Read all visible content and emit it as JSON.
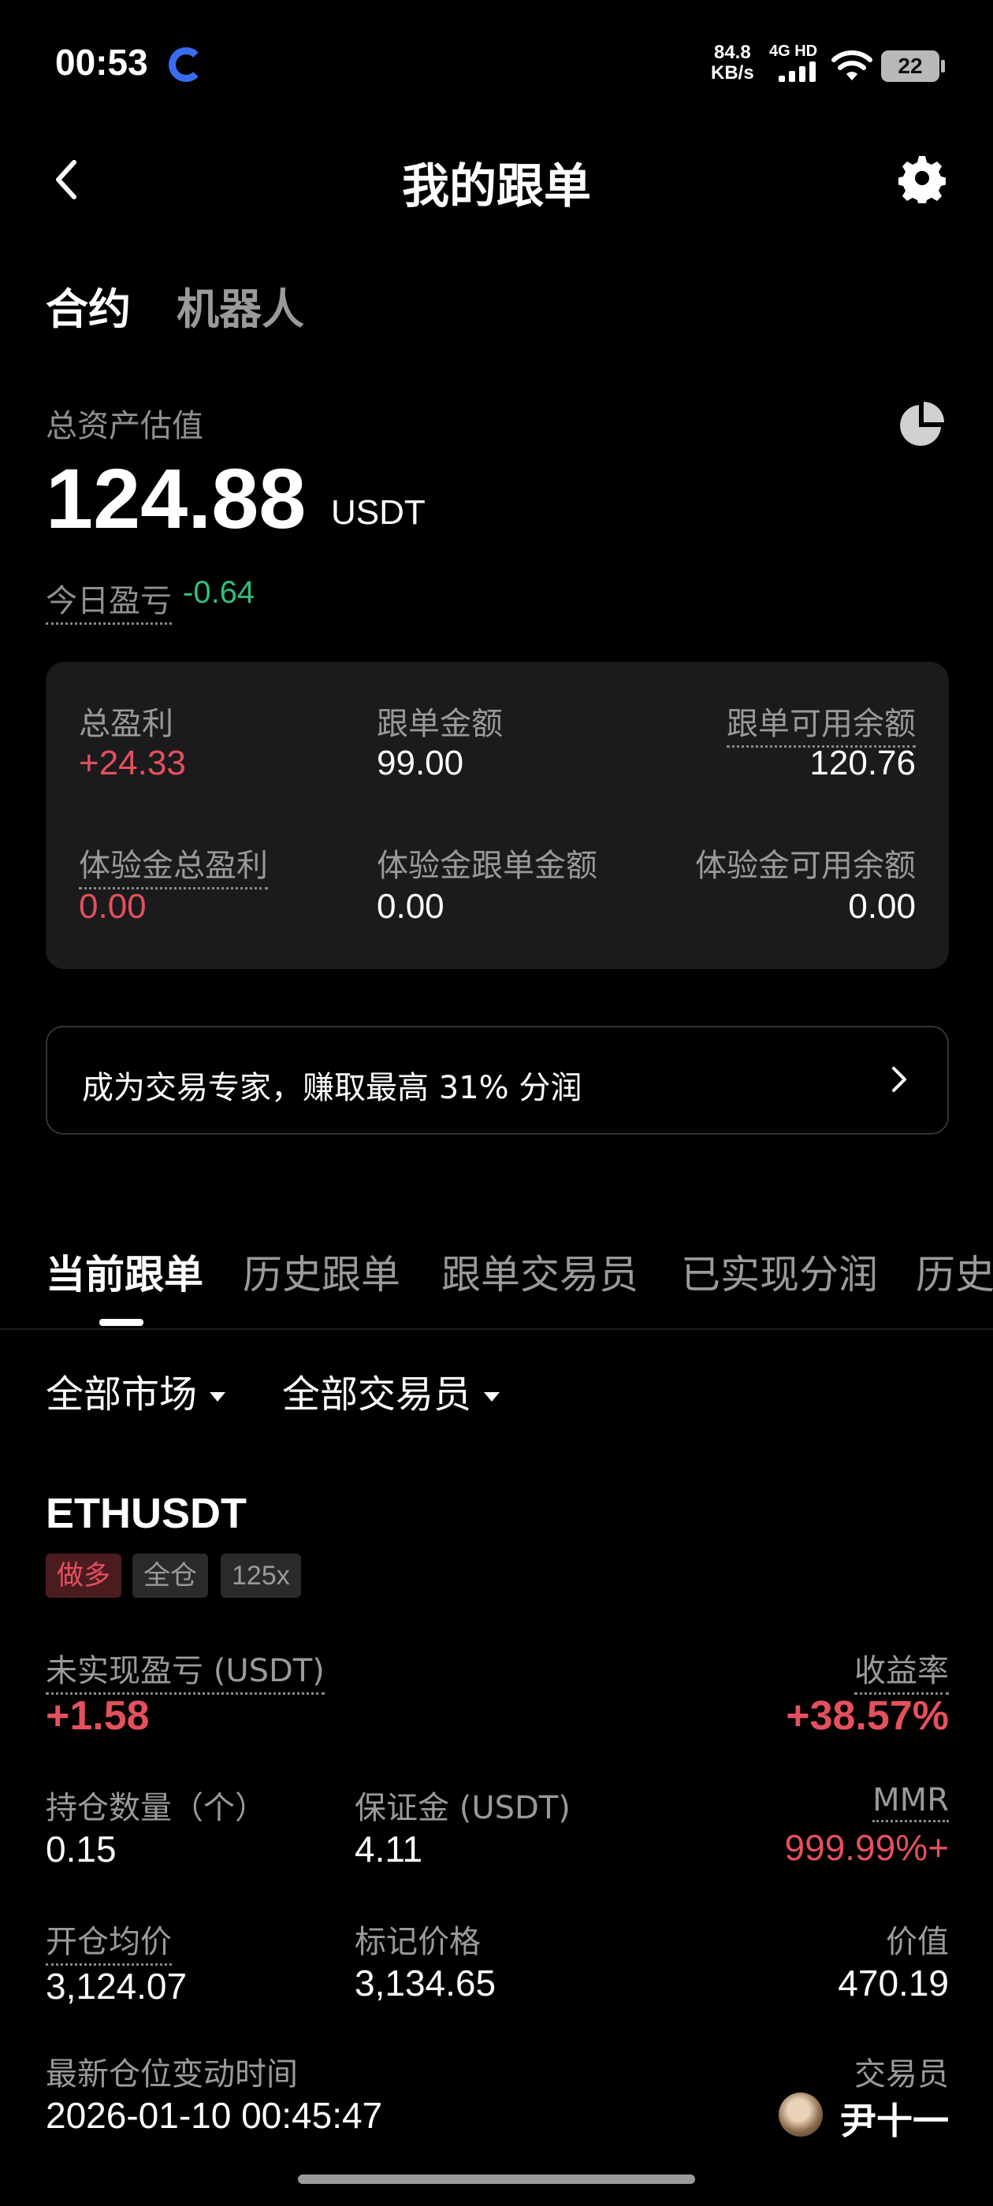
{
  "status_bar": {
    "time": "00:53",
    "net_speed_value": "84.8",
    "net_speed_unit": "KB/s",
    "network": "4G HD",
    "battery": "22"
  },
  "header": {
    "title": "我的跟单"
  },
  "top_tabs": [
    "合约",
    "机器人"
  ],
  "assets": {
    "label": "总资产估值",
    "value": "124.88",
    "unit": "USDT",
    "today_pnl_label": "今日盈亏",
    "today_pnl_value": "-0.64"
  },
  "summary": {
    "total_profit_label": "总盈利",
    "total_profit_value": "+24.33",
    "follow_amount_label": "跟单金额",
    "follow_amount_value": "99.00",
    "available_label": "跟单可用余额",
    "available_value": "120.76",
    "trial_profit_label": "体验金总盈利",
    "trial_profit_value": "0.00",
    "trial_follow_label": "体验金跟单金额",
    "trial_follow_value": "0.00",
    "trial_available_label": "体验金可用余额",
    "trial_available_value": "0.00"
  },
  "promo": {
    "text": "成为交易专家，赚取最高 31% 分润"
  },
  "section_tabs": [
    "当前跟单",
    "历史跟单",
    "跟单交易员",
    "已实现分润",
    "历史"
  ],
  "filters": {
    "market": "全部市场",
    "trader": "全部交易员"
  },
  "position": {
    "symbol": "ETHUSDT",
    "tags": [
      "做多",
      "全仓",
      "125x"
    ],
    "unrealized_label": "未实现盈亏 (USDT)",
    "unrealized_value": "+1.58",
    "roi_label": "收益率",
    "roi_value": "+38.57%",
    "qty_label": "持仓数量（个）",
    "qty_value": "0.15",
    "margin_label": "保证金 (USDT)",
    "margin_value": "4.11",
    "mmr_label": "MMR",
    "mmr_value": "999.99%+",
    "entry_label": "开仓均价",
    "entry_value": "3,124.07",
    "mark_label": "标记价格",
    "mark_value": "3,134.65",
    "value_label": "价值",
    "value_value": "470.19",
    "time_label": "最新仓位变动时间",
    "time_value": "2026-01-10 00:45:47",
    "trader_label": "交易员",
    "trader_name": "尹十一"
  },
  "colors": {
    "positive": "#e5505e",
    "negative": "#2fbf7c",
    "card_bg": "#1b1b1d"
  }
}
